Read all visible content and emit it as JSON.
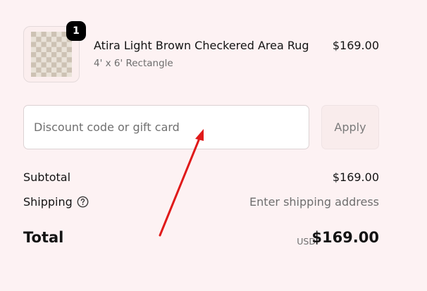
{
  "product": {
    "quantity": "1",
    "name": "Atira Light Brown Checkered Area Rug",
    "variant": "4' x 6' Rectangle",
    "price": "$169.00",
    "image_icon": "checkered-rug-thumbnail"
  },
  "discount": {
    "placeholder": "Discount code or gift card",
    "value": "",
    "apply_label": "Apply"
  },
  "summary": {
    "subtotal_label": "Subtotal",
    "subtotal_value": "$169.00",
    "shipping_label": "Shipping",
    "shipping_value": "Enter shipping address",
    "shipping_help_icon": "question-circle-icon",
    "total_label": "Total",
    "total_currency": "USD",
    "total_value": "$169.00"
  },
  "colors": {
    "background": "#fdf2f3",
    "annotation_arrow": "#e01a1a",
    "rug_light": "#e9e2d8",
    "rug_dark": "#cdc2b4"
  }
}
